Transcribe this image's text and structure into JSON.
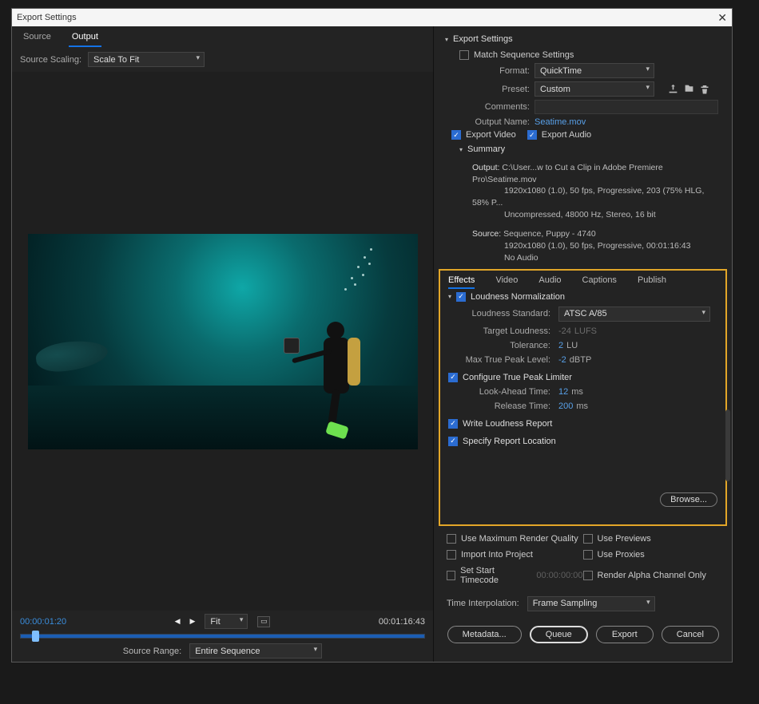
{
  "dialog": {
    "title": "Export Settings"
  },
  "left": {
    "tabs": [
      "Source",
      "Output"
    ],
    "active_tab": 1,
    "scaling_label": "Source Scaling:",
    "scaling_value": "Scale To Fit",
    "tc_left": "00:00:01:20",
    "fit_label": "Fit",
    "tc_right": "00:01:16:43",
    "source_range_label": "Source Range:",
    "source_range_value": "Entire Sequence"
  },
  "settings": {
    "header": "Export Settings",
    "match_seq_label": "Match Sequence Settings",
    "format_label": "Format:",
    "format_value": "QuickTime",
    "preset_label": "Preset:",
    "preset_value": "Custom",
    "comments_label": "Comments:",
    "output_name_label": "Output Name:",
    "output_name_value": "Seatime.mov",
    "export_video_label": "Export Video",
    "export_audio_label": "Export Audio",
    "summary_label": "Summary",
    "summary_output_label": "Output:",
    "summary_output_lines": [
      "C:\\User...w to Cut a Clip in Adobe Premiere Pro\\Seatime.mov",
      "1920x1080 (1.0), 50 fps, Progressive, 203 (75% HLG, 58% P...",
      "Uncompressed, 48000 Hz, Stereo, 16 bit"
    ],
    "summary_source_label": "Source:",
    "summary_source_lines": [
      "Sequence, Puppy - 4740",
      "1920x1080 (1.0), 50 fps, Progressive, 00:01:16:43",
      "No Audio"
    ]
  },
  "effects": {
    "tabs": [
      "Effects",
      "Video",
      "Audio",
      "Captions",
      "Publish"
    ],
    "active_tab": 0,
    "section_label": "Loudness Normalization",
    "std_label": "Loudness Standard:",
    "std_value": "ATSC A/85",
    "target_label": "Target Loudness:",
    "target_value": "-24",
    "target_unit": "LUFS",
    "tol_label": "Tolerance:",
    "tol_value": "2",
    "tol_unit": "LU",
    "peak_label": "Max True Peak Level:",
    "peak_value": "-2",
    "peak_unit": "dBTP",
    "limiter_label": "Configure True Peak Limiter",
    "look_label": "Look-Ahead Time:",
    "look_value": "12",
    "look_unit": "ms",
    "release_label": "Release Time:",
    "release_value": "200",
    "release_unit": "ms",
    "report_label": "Write Loudness Report",
    "specify_label": "Specify Report Location",
    "browse_label": "Browse..."
  },
  "render": {
    "max_quality": "Use Maximum Render Quality",
    "previews": "Use Previews",
    "import": "Import Into Project",
    "proxies": "Use Proxies",
    "start_tc": "Set Start Timecode",
    "start_tc_val": "00:00:00:00",
    "alpha": "Render Alpha Channel Only",
    "ti_label": "Time Interpolation:",
    "ti_value": "Frame Sampling"
  },
  "footer": {
    "metadata": "Metadata...",
    "queue": "Queue",
    "export": "Export",
    "cancel": "Cancel"
  }
}
